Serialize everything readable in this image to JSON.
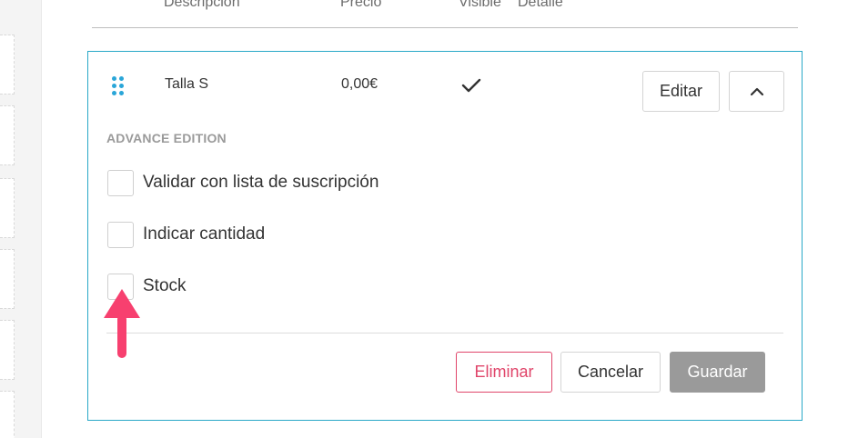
{
  "table_header": {
    "columns": [
      "Descripción",
      "Precio",
      "Visible",
      "Detalle"
    ]
  },
  "item": {
    "description": "Talla S",
    "price": "0,00€",
    "visible": true,
    "edit_label": "Editar",
    "collapse_icon": "chevron-up-icon",
    "drag_icon": "drag-handle-icon"
  },
  "advance_edition": {
    "title": "ADVANCE EDITION",
    "options": [
      {
        "label": "Validar con lista de suscripción",
        "checked": false
      },
      {
        "label": "Indicar cantidad",
        "checked": false
      },
      {
        "label": "Stock",
        "checked": false
      }
    ]
  },
  "actions": {
    "delete_label": "Eliminar",
    "cancel_label": "Cancelar",
    "save_label": "Guardar"
  },
  "colors": {
    "card_border": "#29a8c7",
    "drag_handle": "#2aa6d8",
    "danger": "#e0456a",
    "disabled_button": "#9a9a9a",
    "annotation_arrow": "#f7406f"
  }
}
